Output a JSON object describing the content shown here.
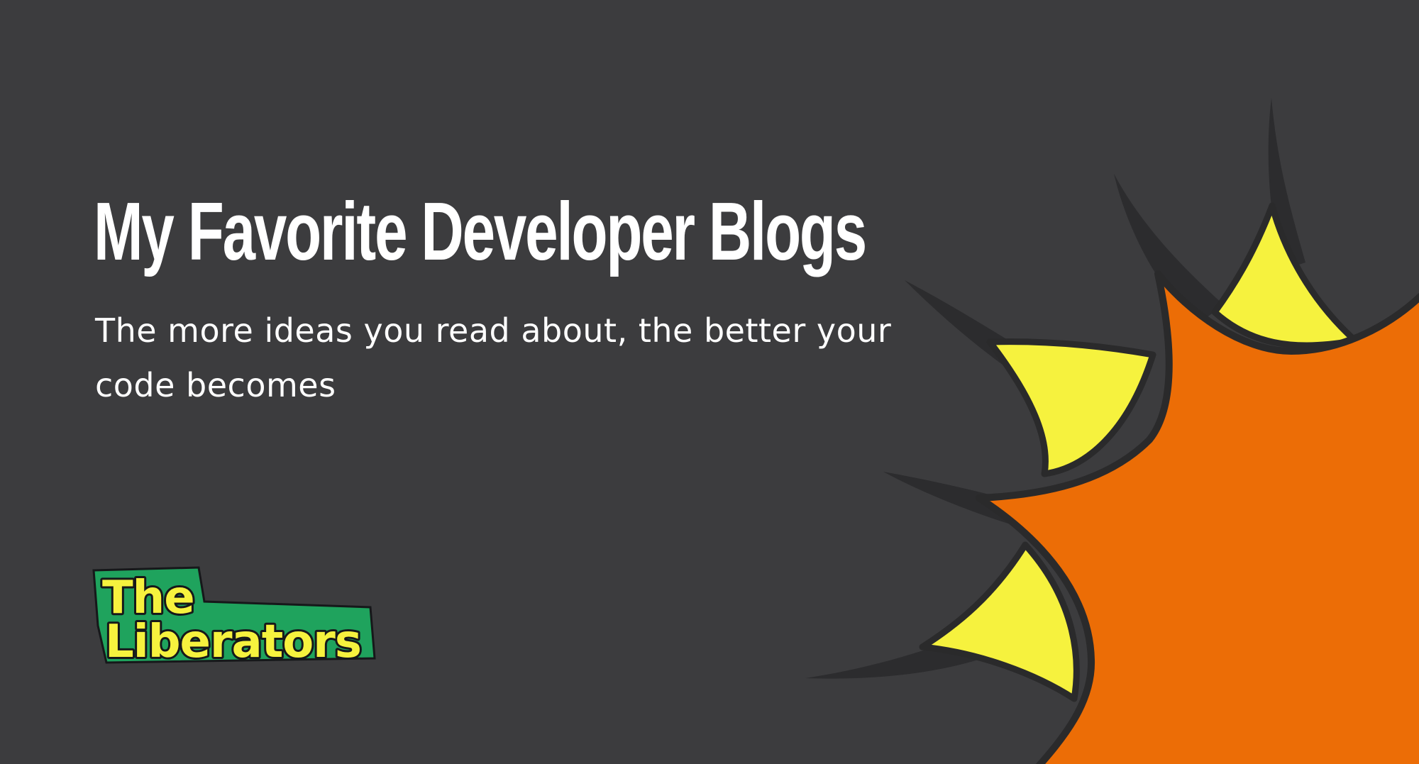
{
  "hero": {
    "title": "My Favorite Developer Blogs",
    "subtitle": "The more ideas you read about, the better your code becomes"
  },
  "logo": {
    "line1": "The",
    "line2": "Liberators"
  },
  "colors": {
    "background": "#3c3c3e",
    "text": "#ffffff",
    "burst_orange": "#ec6d06",
    "burst_yellow": "#f6f23e",
    "burst_outline": "#2a2a2b",
    "logo_green": "#1fa35d",
    "logo_yellow": "#f6f23e"
  },
  "icons": {
    "decoration": "starburst-icon",
    "brand": "liberators-logo"
  }
}
